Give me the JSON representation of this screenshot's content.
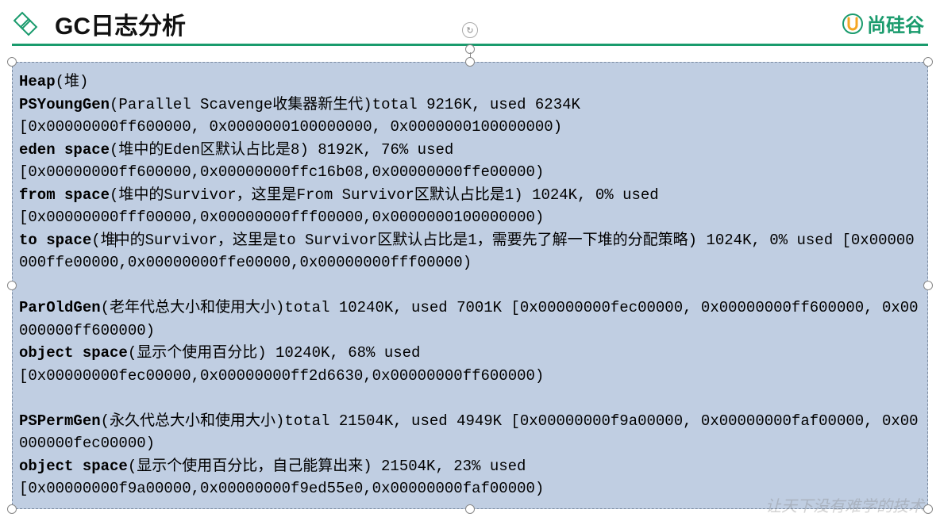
{
  "header": {
    "title": "GC日志分析",
    "brand": "尚硅谷"
  },
  "log": {
    "heap_label": "Heap",
    "heap_note": "(堆)",
    "young_label": "PSYoungGen",
    "young_desc": "(Parallel Scavenge收集器新生代)total 9216K, used 6234K",
    "young_addr": "[0x00000000ff600000, 0x0000000100000000, 0x0000000100000000)",
    "eden_label": "eden space",
    "eden_desc": "(堆中的Eden区默认占比是8) 8192K, 76% used",
    "eden_addr": "[0x00000000ff600000,0x00000000ffc16b08,0x00000000ffe00000)",
    "from_label": "from space",
    "from_desc": "(堆中的Survivor，这里是From Survivor区默认占比是1) 1024K, 0% used",
    "from_addr": "[0x00000000fff00000,0x00000000fff00000,0x0000000100000000)",
    "to_label": "to space",
    "to_desc_a": "(堆",
    "to_desc_b": "中的Survivor，这里是to Survivor区默认占比是1，需要先了解一下堆的分配策略) 1024K, 0% used [0x00000000ffe00000,0x00000000ffe00000,0x00000000fff00000)",
    "old_label": "ParOldGen",
    "old_desc": "(老年代总大小和使用大小)total 10240K, used 7001K [0x00000000fec00000, 0x00000000ff600000, 0x00000000ff600000)",
    "old_obj_label": "object space",
    "old_obj_desc": "(显示个使用百分比) 10240K, 68% used",
    "old_obj_addr": "[0x00000000fec00000,0x00000000ff2d6630,0x00000000ff600000)",
    "perm_label": "PSPermGen",
    "perm_desc": "(永久代总大小和使用大小)total 21504K, used 4949K [0x00000000f9a00000, 0x00000000faf00000, 0x00000000fec00000)",
    "perm_obj_label": "object space",
    "perm_obj_desc": "(显示个使用百分比，自己能算出来) 21504K, 23% used",
    "perm_obj_addr": "[0x00000000f9a00000,0x00000000f9ed55e0,0x00000000faf00000)"
  },
  "watermark": "让天下没有难学的技术"
}
